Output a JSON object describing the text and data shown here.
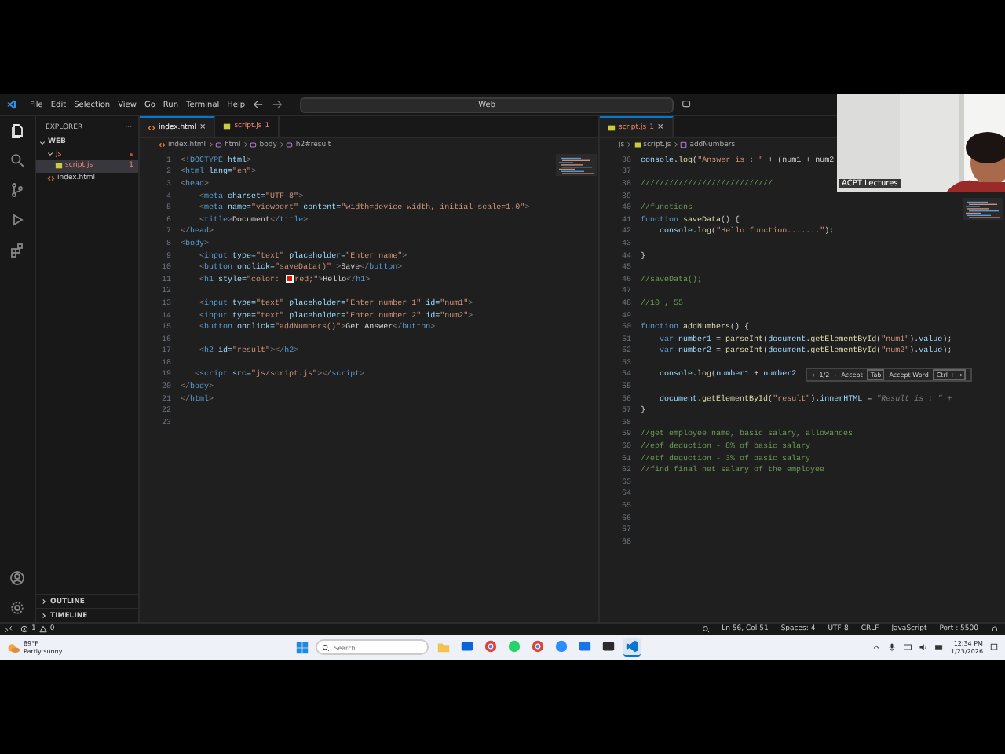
{
  "title_bar": {
    "menu": [
      "File",
      "Edit",
      "Selection",
      "View",
      "Go",
      "Run",
      "Terminal",
      "Help"
    ],
    "command_center": "Web"
  },
  "activity_bar": [
    {
      "kind": "files",
      "selected": true
    },
    {
      "kind": "search",
      "selected": false
    },
    {
      "kind": "source-control",
      "selected": false
    },
    {
      "kind": "run",
      "selected": false
    },
    {
      "kind": "extensions",
      "selected": false
    }
  ],
  "sidebar": {
    "title": "EXPLORER",
    "more": "···",
    "tree": [
      {
        "label": "WEB",
        "kind": "root",
        "expanded": true,
        "selected": false,
        "error": false,
        "children": [
          {
            "label": "js",
            "kind": "folder",
            "expanded": true,
            "selected": false,
            "error": true,
            "children": [
              {
                "label": "script.js",
                "kind": "js",
                "selected": true,
                "error": true,
                "badge": "1"
              }
            ]
          },
          {
            "label": "index.html",
            "kind": "html",
            "selected": false,
            "error": false
          }
        ]
      }
    ],
    "sections": [
      {
        "label": "OUTLINE",
        "expanded": false
      },
      {
        "label": "TIMELINE",
        "expanded": false
      }
    ]
  },
  "editors": [
    {
      "tabs": [
        {
          "kind": "html",
          "label": "index.html",
          "selected": true,
          "error": false,
          "close": "×"
        },
        {
          "kind": "js",
          "label": "script.js",
          "selected": false,
          "error": true,
          "badge": "1"
        }
      ],
      "breadcrumb": [
        {
          "kind": "html",
          "label": "index.html"
        },
        {
          "kind": "element",
          "label": "html"
        },
        {
          "kind": "element",
          "label": "body"
        },
        {
          "kind": "element",
          "label": "h2#result"
        }
      ],
      "lines": [
        {
          "n": "1",
          "tokens": [
            {
              "kind": "p",
              "t": "<!"
            },
            {
              "kind": "tag",
              "t": "DOCTYPE"
            },
            {
              "kind": "attr",
              "t": " html"
            },
            {
              "kind": "p",
              "t": ">"
            }
          ]
        },
        {
          "n": "2",
          "tokens": [
            {
              "kind": "p",
              "t": "<"
            },
            {
              "kind": "tag",
              "t": "html"
            },
            {
              "kind": "attr",
              "t": " lang="
            },
            {
              "kind": "str",
              "t": "\"en\""
            },
            {
              "kind": "p",
              "t": ">"
            }
          ]
        },
        {
          "n": "3",
          "tokens": [
            {
              "kind": "p",
              "t": "<"
            },
            {
              "kind": "tag",
              "t": "head"
            },
            {
              "kind": "p",
              "t": ">"
            }
          ]
        },
        {
          "n": "4",
          "tokens": [
            {
              "kind": "p",
              "t": "    <"
            },
            {
              "kind": "tag",
              "t": "meta"
            },
            {
              "kind": "attr",
              "t": " charset="
            },
            {
              "kind": "str",
              "t": "\"UTF-8\""
            },
            {
              "kind": "p",
              "t": ">"
            }
          ]
        },
        {
          "n": "5",
          "tokens": [
            {
              "kind": "p",
              "t": "    <"
            },
            {
              "kind": "tag",
              "t": "meta"
            },
            {
              "kind": "attr",
              "t": " name="
            },
            {
              "kind": "str",
              "t": "\"viewport\""
            },
            {
              "kind": "attr",
              "t": " content="
            },
            {
              "kind": "str",
              "t": "\"width=device-width, initial-scale=1.0\""
            },
            {
              "kind": "p",
              "t": ">"
            }
          ]
        },
        {
          "n": "6",
          "tokens": [
            {
              "kind": "p",
              "t": "    <"
            },
            {
              "kind": "tag",
              "t": "title"
            },
            {
              "kind": "p",
              "t": ">"
            },
            {
              "kind": "text",
              "t": "Document"
            },
            {
              "kind": "p",
              "t": "</"
            },
            {
              "kind": "tag",
              "t": "title"
            },
            {
              "kind": "p",
              "t": ">"
            }
          ]
        },
        {
          "n": "7",
          "tokens": [
            {
              "kind": "p",
              "t": "</"
            },
            {
              "kind": "tag",
              "t": "head"
            },
            {
              "kind": "p",
              "t": ">"
            }
          ]
        },
        {
          "n": "8",
          "tokens": [
            {
              "kind": "p",
              "t": "<"
            },
            {
              "kind": "tag",
              "t": "body"
            },
            {
              "kind": "p",
              "t": ">"
            }
          ]
        },
        {
          "n": "9",
          "tokens": [
            {
              "kind": "p",
              "t": "    <"
            },
            {
              "kind": "tag",
              "t": "input"
            },
            {
              "kind": "attr",
              "t": " type="
            },
            {
              "kind": "str",
              "t": "\"text\""
            },
            {
              "kind": "attr",
              "t": " placeholder="
            },
            {
              "kind": "str",
              "t": "\"Enter name\""
            },
            {
              "kind": "p",
              "t": ">"
            }
          ]
        },
        {
          "n": "10",
          "tokens": [
            {
              "kind": "p",
              "t": "    <"
            },
            {
              "kind": "tag",
              "t": "button"
            },
            {
              "kind": "attr",
              "t": " onclick="
            },
            {
              "kind": "str",
              "t": "\"saveData()\""
            },
            {
              "kind": "p",
              "t": " >"
            },
            {
              "kind": "text",
              "t": "Save"
            },
            {
              "kind": "p",
              "t": "</"
            },
            {
              "kind": "tag",
              "t": "button"
            },
            {
              "kind": "p",
              "t": ">"
            }
          ]
        },
        {
          "n": "11",
          "tokens": [
            {
              "kind": "p",
              "t": "    <"
            },
            {
              "kind": "tag",
              "t": "h1"
            },
            {
              "kind": "attr",
              "t": " style="
            },
            {
              "kind": "str",
              "t": "\"color: "
            },
            {
              "kind": "swatch",
              "color": "#e51400"
            },
            {
              "kind": "str",
              "t": "red;\""
            },
            {
              "kind": "p",
              "t": ">"
            },
            {
              "kind": "text",
              "t": "Hello"
            },
            {
              "kind": "p",
              "t": "</"
            },
            {
              "kind": "tag",
              "t": "h1"
            },
            {
              "kind": "p",
              "t": ">"
            }
          ]
        },
        {
          "n": "12"
        },
        {
          "n": "13",
          "tokens": [
            {
              "kind": "p",
              "t": "    <"
            },
            {
              "kind": "tag",
              "t": "input"
            },
            {
              "kind": "attr",
              "t": " type="
            },
            {
              "kind": "str",
              "t": "\"text\""
            },
            {
              "kind": "attr",
              "t": " placeholder="
            },
            {
              "kind": "str",
              "t": "\"Enter number 1\""
            },
            {
              "kind": "attr",
              "t": " id="
            },
            {
              "kind": "str",
              "t": "\"num1\""
            },
            {
              "kind": "p",
              "t": ">"
            }
          ]
        },
        {
          "n": "14",
          "tokens": [
            {
              "kind": "p",
              "t": "    <"
            },
            {
              "kind": "tag",
              "t": "input"
            },
            {
              "kind": "attr",
              "t": " type="
            },
            {
              "kind": "str",
              "t": "\"text\""
            },
            {
              "kind": "attr",
              "t": " placeholder="
            },
            {
              "kind": "str",
              "t": "\"Enter number 2\""
            },
            {
              "kind": "attr",
              "t": " id="
            },
            {
              "kind": "str",
              "t": "\"num2\""
            },
            {
              "kind": "p",
              "t": ">"
            }
          ]
        },
        {
          "n": "15",
          "tokens": [
            {
              "kind": "p",
              "t": "    <"
            },
            {
              "kind": "tag",
              "t": "button"
            },
            {
              "kind": "attr",
              "t": " onclick="
            },
            {
              "kind": "str",
              "t": "\"addNumbers()\""
            },
            {
              "kind": "p",
              "t": ">"
            },
            {
              "kind": "text",
              "t": "Get Answer"
            },
            {
              "kind": "p",
              "t": "</"
            },
            {
              "kind": "tag",
              "t": "button"
            },
            {
              "kind": "p",
              "t": ">"
            }
          ]
        },
        {
          "n": "16"
        },
        {
          "n": "17",
          "tokens": [
            {
              "kind": "p",
              "t": "    <"
            },
            {
              "kind": "tag",
              "t": "h2"
            },
            {
              "kind": "attr",
              "t": " id="
            },
            {
              "kind": "str",
              "t": "\"result\""
            },
            {
              "kind": "p",
              "t": "></"
            },
            {
              "kind": "tag",
              "t": "h2"
            },
            {
              "kind": "p",
              "t": ">"
            }
          ]
        },
        {
          "n": "18"
        },
        {
          "n": "19",
          "tokens": [
            {
              "kind": "p",
              "t": "   <"
            },
            {
              "kind": "tag",
              "t": "script"
            },
            {
              "kind": "attr",
              "t": " src="
            },
            {
              "kind": "str",
              "t": "\"js/script.js\""
            },
            {
              "kind": "p",
              "t": "></"
            },
            {
              "kind": "tag",
              "t": "script"
            },
            {
              "kind": "p",
              "t": ">"
            }
          ]
        },
        {
          "n": "20",
          "tokens": [
            {
              "kind": "p",
              "t": "</"
            },
            {
              "kind": "tag",
              "t": "body"
            },
            {
              "kind": "p",
              "t": ">"
            }
          ]
        },
        {
          "n": "21",
          "tokens": [
            {
              "kind": "p",
              "t": "</"
            },
            {
              "kind": "tag",
              "t": "html"
            },
            {
              "kind": "p",
              "t": ">"
            }
          ]
        },
        {
          "n": "22"
        },
        {
          "n": "23"
        }
      ]
    },
    {
      "tabs": [
        {
          "kind": "js",
          "label": "script.js",
          "selected": true,
          "error": true,
          "badge": "1",
          "close": "×"
        }
      ],
      "breadcrumb": [
        {
          "kind": "folder",
          "label": "js"
        },
        {
          "kind": "js",
          "label": "script.js"
        },
        {
          "kind": "function",
          "label": "addNumbers"
        }
      ],
      "lines": [
        {
          "n": "36",
          "tokens": [
            {
              "kind": "var",
              "t": "console"
            },
            {
              "kind": "text",
              "t": "."
            },
            {
              "kind": "fn",
              "t": "log"
            },
            {
              "kind": "text",
              "t": "("
            },
            {
              "kind": "str",
              "t": "\"Answer is : \""
            },
            {
              "kind": "text",
              "t": " + (num1 + num2"
            }
          ]
        },
        {
          "n": "37"
        },
        {
          "n": "38",
          "tokens": [
            {
              "kind": "com",
              "t": "////////////////////////////"
            }
          ]
        },
        {
          "n": "39"
        },
        {
          "n": "40",
          "tokens": [
            {
              "kind": "com",
              "t": "//functions"
            }
          ]
        },
        {
          "n": "41",
          "tokens": [
            {
              "kind": "kw",
              "t": "function"
            },
            {
              "kind": "fn",
              "t": " saveData"
            },
            {
              "kind": "text",
              "t": "() {"
            }
          ]
        },
        {
          "n": "42",
          "tokens": [
            {
              "kind": "var",
              "t": "    console"
            },
            {
              "kind": "text",
              "t": "."
            },
            {
              "kind": "fn",
              "t": "log"
            },
            {
              "kind": "text",
              "t": "("
            },
            {
              "kind": "str",
              "t": "\"Hello function.......\""
            },
            {
              "kind": "text",
              "t": ");"
            }
          ]
        },
        {
          "n": "43"
        },
        {
          "n": "44",
          "tokens": [
            {
              "kind": "text",
              "t": "}"
            }
          ]
        },
        {
          "n": "45"
        },
        {
          "n": "46",
          "tokens": [
            {
              "kind": "com",
              "t": "//saveData();"
            }
          ]
        },
        {
          "n": "47"
        },
        {
          "n": "48",
          "tokens": [
            {
              "kind": "com",
              "t": "//10 , 55"
            }
          ]
        },
        {
          "n": "49"
        },
        {
          "n": "50",
          "tokens": [
            {
              "kind": "kw",
              "t": "function"
            },
            {
              "kind": "fn",
              "t": " addNumbers"
            },
            {
              "kind": "text",
              "t": "() {"
            }
          ]
        },
        {
          "n": "51",
          "tokens": [
            {
              "kind": "kw",
              "t": "    var"
            },
            {
              "kind": "var",
              "t": " number1"
            },
            {
              "kind": "text",
              "t": " = "
            },
            {
              "kind": "fn",
              "t": "parseInt"
            },
            {
              "kind": "text",
              "t": "("
            },
            {
              "kind": "var",
              "t": "document"
            },
            {
              "kind": "text",
              "t": "."
            },
            {
              "kind": "fn",
              "t": "getElementById"
            },
            {
              "kind": "text",
              "t": "("
            },
            {
              "kind": "str",
              "t": "\"num1\""
            },
            {
              "kind": "text",
              "t": ")."
            },
            {
              "kind": "var",
              "t": "value"
            },
            {
              "kind": "text",
              "t": ");"
            }
          ]
        },
        {
          "n": "52",
          "tokens": [
            {
              "kind": "kw",
              "t": "    var"
            },
            {
              "kind": "var",
              "t": " number2"
            },
            {
              "kind": "text",
              "t": " = "
            },
            {
              "kind": "fn",
              "t": "parseInt"
            },
            {
              "kind": "text",
              "t": "("
            },
            {
              "kind": "var",
              "t": "document"
            },
            {
              "kind": "text",
              "t": "."
            },
            {
              "kind": "fn",
              "t": "getElementById"
            },
            {
              "kind": "text",
              "t": "("
            },
            {
              "kind": "str",
              "t": "\"num2\""
            },
            {
              "kind": "text",
              "t": ")."
            },
            {
              "kind": "var",
              "t": "value"
            },
            {
              "kind": "text",
              "t": ");"
            }
          ]
        },
        {
          "n": "53"
        },
        {
          "n": "54",
          "tokens": [
            {
              "kind": "var",
              "t": "    console"
            },
            {
              "kind": "text",
              "t": "."
            },
            {
              "kind": "fn",
              "t": "log"
            },
            {
              "kind": "text",
              "t": "("
            },
            {
              "kind": "var",
              "t": "number1"
            },
            {
              "kind": "text",
              "t": " + "
            },
            {
              "kind": "var",
              "t": "number2"
            }
          ],
          "widget": {
            "prev": "‹",
            "count": "1/2",
            "next": "›",
            "accept": "Accept",
            "accept_key": "Tab",
            "accept_word": "Accept Word",
            "word_keys": "Ctrl + →"
          }
        },
        {
          "n": "55"
        },
        {
          "n": "56",
          "tokens": [
            {
              "kind": "var",
              "t": "    document"
            },
            {
              "kind": "text",
              "t": "."
            },
            {
              "kind": "fn",
              "t": "getElementById"
            },
            {
              "kind": "text",
              "t": "("
            },
            {
              "kind": "str",
              "t": "\"result\""
            },
            {
              "kind": "text",
              "t": ")."
            },
            {
              "kind": "var",
              "t": "innerHTML"
            },
            {
              "kind": "text",
              "t": " = "
            },
            {
              "kind": "ghost",
              "t": "\"Result is : \" +"
            }
          ]
        },
        {
          "n": "57",
          "tokens": [
            {
              "kind": "text",
              "t": "}"
            }
          ]
        },
        {
          "n": "58"
        },
        {
          "n": "59",
          "tokens": [
            {
              "kind": "com",
              "t": "//get employee name, basic salary, allowances"
            }
          ]
        },
        {
          "n": "60",
          "tokens": [
            {
              "kind": "com",
              "t": "//epf deduction - 8% of basic salary"
            }
          ]
        },
        {
          "n": "61",
          "tokens": [
            {
              "kind": "com",
              "t": "//etf deduction - 3% of basic salary"
            }
          ]
        },
        {
          "n": "62",
          "tokens": [
            {
              "kind": "com",
              "t": "//find final net salary of the employee"
            }
          ]
        },
        {
          "n": "63"
        },
        {
          "n": "64"
        },
        {
          "n": "65"
        },
        {
          "n": "66"
        },
        {
          "n": "67"
        },
        {
          "n": "68"
        }
      ]
    }
  ],
  "status_bar": {
    "errors": "1",
    "warnings": "0",
    "right": [
      {
        "kind": "zoom"
      },
      {
        "kind": "text",
        "label": "Ln 56, Col 51"
      },
      {
        "kind": "text",
        "label": "Spaces: 4"
      },
      {
        "kind": "text",
        "label": "UTF-8"
      },
      {
        "kind": "text",
        "label": "CRLF"
      },
      {
        "kind": "language",
        "label": "JavaScript"
      },
      {
        "kind": "port",
        "label": "Port : 5500"
      }
    ]
  },
  "taskbar": {
    "weather": {
      "temp": "89°F",
      "desc": "Partly sunny"
    },
    "search": {
      "placeholder": "Search"
    },
    "apps": [
      {
        "kind": "folder",
        "active": false
      },
      {
        "kind": "outlook",
        "active": false
      },
      {
        "kind": "chrome",
        "active": false
      },
      {
        "kind": "chat",
        "active": false
      },
      {
        "kind": "chrome",
        "active": false
      },
      {
        "kind": "meet",
        "active": false
      },
      {
        "kind": "mail",
        "active": false
      },
      {
        "kind": "terminal",
        "active": false
      },
      {
        "kind": "vscode",
        "active": true
      }
    ],
    "time": "12:34 PM",
    "date": "1/23/2026"
  },
  "webcam": {
    "name": "ACPT Lectures"
  }
}
